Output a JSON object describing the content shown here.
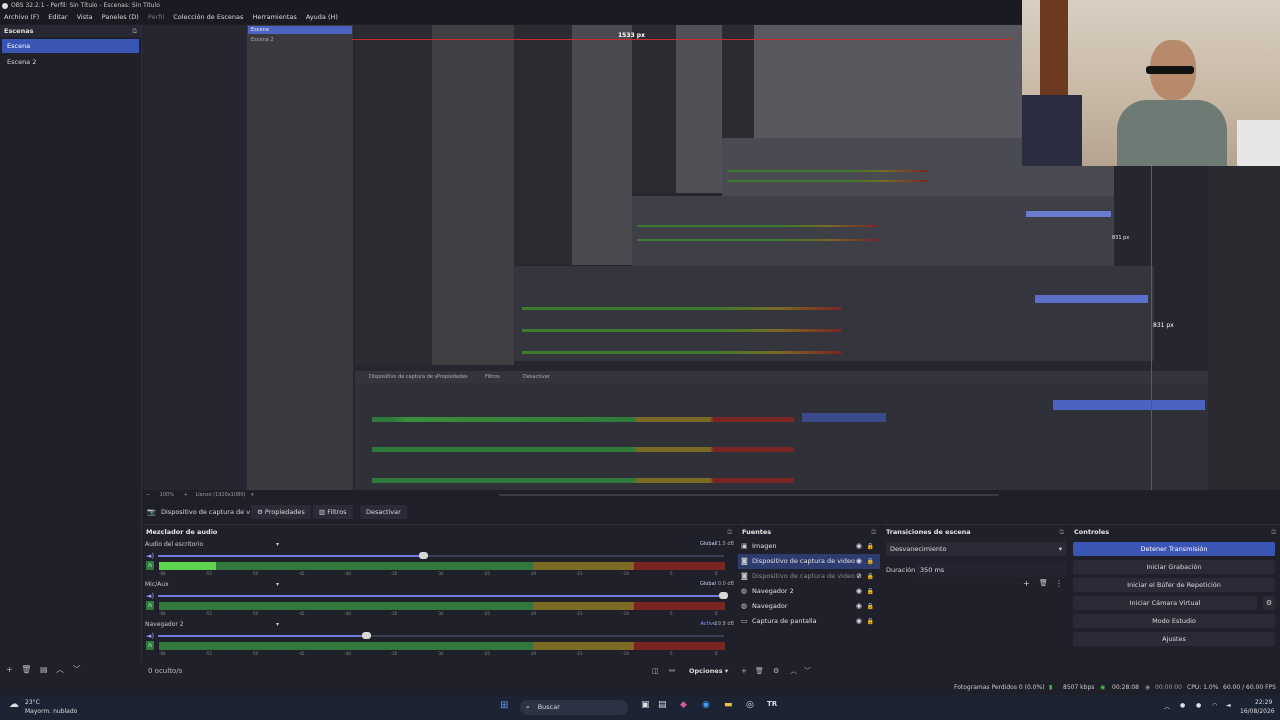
{
  "window": {
    "title": "OBS 32.2.1 - Perfil: Sin Título - Escenas: Sin Título"
  },
  "menu": [
    "Archivo (F)",
    "Editar",
    "Vista",
    "Paneles (D)",
    "Perfil",
    "Colección de Escenas",
    "Herramientas",
    "Ayuda (H)"
  ],
  "scenes": {
    "title": "Escenas",
    "items": [
      {
        "label": "Escena"
      },
      {
        "label": "Escena 2"
      }
    ]
  },
  "preview": {
    "measure_top": "1533 px",
    "measure_mid": "831 px",
    "measure_right": "831 px",
    "nested_1": {
      "scene_a": "Escena",
      "scene_b": "Escena 2"
    },
    "zoom": "100%",
    "canvas": "Lienzo (1920x1080)"
  },
  "context": {
    "source": "Dispositivo de captura de v",
    "properties": "Propiedades",
    "filters": "Filtros",
    "deactivate": "Desactivar"
  },
  "mixer": {
    "title": "Mezclador de audio",
    "channels": [
      {
        "name": "Audio del escritorio",
        "tag": "Global",
        "db": "-21.5 dB",
        "volume": 0.47,
        "level": 0.1
      },
      {
        "name": "Mic/Aux",
        "tag": "Global",
        "db": "0.0 dB",
        "volume": 1.0,
        "level": 0.0
      },
      {
        "name": "Navegador 2",
        "tag": "Activo",
        "db": "-29.8 dB",
        "volume": 0.37,
        "level": 0.0
      }
    ],
    "ticks": [
      "-60",
      "-55",
      "-50",
      "-45",
      "-40",
      "-35",
      "-30",
      "-25",
      "-20",
      "-15",
      "-10",
      "-5",
      "0"
    ],
    "hidden": "0 oculto/s",
    "options": "Opciones"
  },
  "sources": {
    "title": "Fuentes",
    "items": [
      {
        "label": "Imagen",
        "icon": "image-icon",
        "selected": false,
        "disabled": false
      },
      {
        "label": "Dispositivo de captura de video",
        "icon": "camera-icon",
        "selected": true,
        "disabled": false
      },
      {
        "label": "Dispositivo de captura de video 2",
        "icon": "camera-icon",
        "selected": false,
        "disabled": true
      },
      {
        "label": "Navegador 2",
        "icon": "globe-icon",
        "selected": false,
        "disabled": false
      },
      {
        "label": "Navegador",
        "icon": "globe-icon",
        "selected": false,
        "disabled": false
      },
      {
        "label": "Captura de pantalla",
        "icon": "monitor-icon",
        "selected": false,
        "disabled": false
      }
    ]
  },
  "transitions": {
    "title": "Transiciones de escena",
    "selected": "Desvanecimiento",
    "duration_label": "Duración",
    "duration_value": "350 ms"
  },
  "controls": {
    "title": "Controles",
    "buttons": [
      "Detener Transmisión",
      "Iniciar Grabación",
      "Iniciar el Búfer de Repetición",
      "Iniciar Cámara Virtual",
      "Modo Estudio",
      "Ajustes"
    ]
  },
  "status": {
    "dropped": "Fotogramas Perdidos 0 (0.0%)",
    "bitrate": "8507 kbps",
    "stream_time": "00:28:08",
    "rec_time": "00:00:00",
    "cpu": "CPU: 1.0%",
    "fps": "60.00 / 60.00 FPS"
  },
  "taskbar": {
    "weather_temp": "23°C",
    "weather_desc": "Mayorm. nublado",
    "search": "Buscar",
    "time": "22:29",
    "date": "16/08/2026"
  },
  "colors": {
    "accent": "#3b55b5",
    "meter_green": "#2f7a3a",
    "meter_yellow": "#7a6a24",
    "meter_red": "#7a2424"
  }
}
